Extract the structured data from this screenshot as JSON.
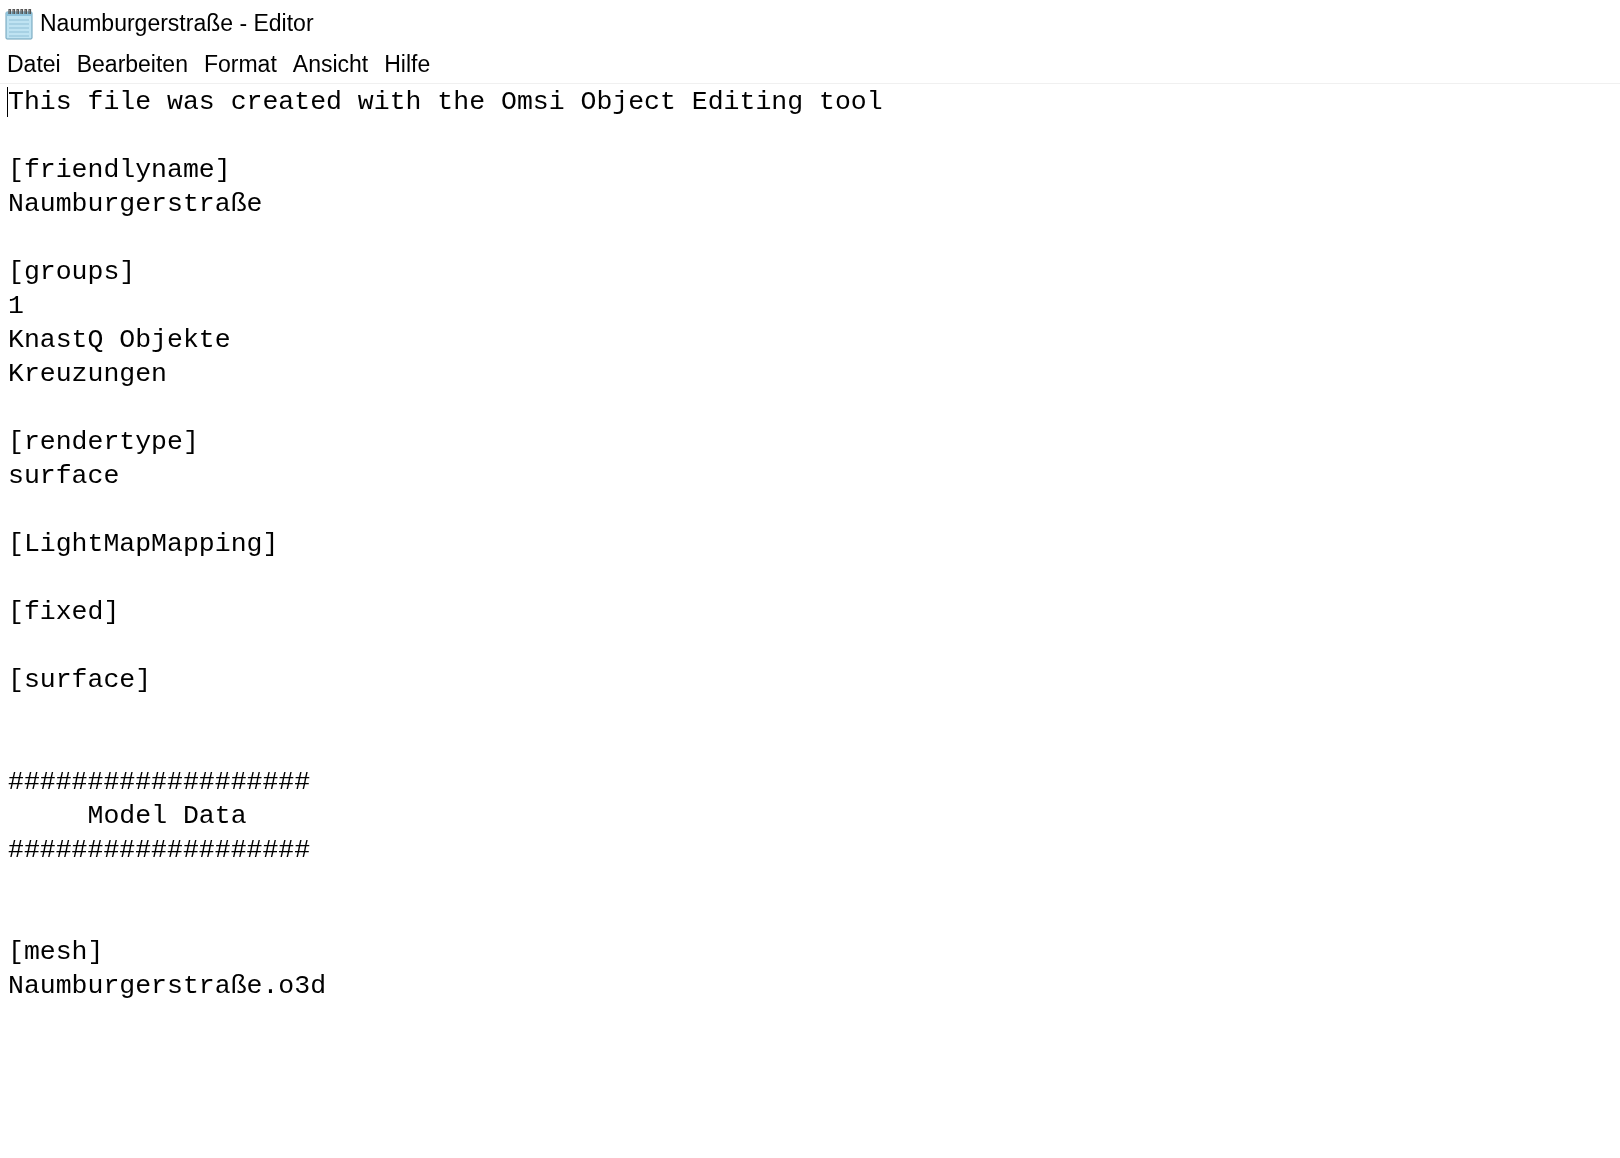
{
  "window": {
    "title": "Naumburgerstraße - Editor"
  },
  "menu": [
    {
      "label": "Datei"
    },
    {
      "label": "Bearbeiten"
    },
    {
      "label": "Format"
    },
    {
      "label": "Ansicht"
    },
    {
      "label": "Hilfe"
    }
  ],
  "editor": {
    "caret": true,
    "content": "This file was created with the Omsi Object Editing tool\n\n[friendlyname]\nNaumburgerstraße\n\n[groups]\n1\nKnastQ Objekte\nKreuzungen\n\n[rendertype]\nsurface\n\n[LightMapMapping]\n\n[fixed]\n\n[surface]\n\n\n###################\n     Model Data\n###################\n\n\n[mesh]\nNaumburgerstraße.o3d"
  }
}
